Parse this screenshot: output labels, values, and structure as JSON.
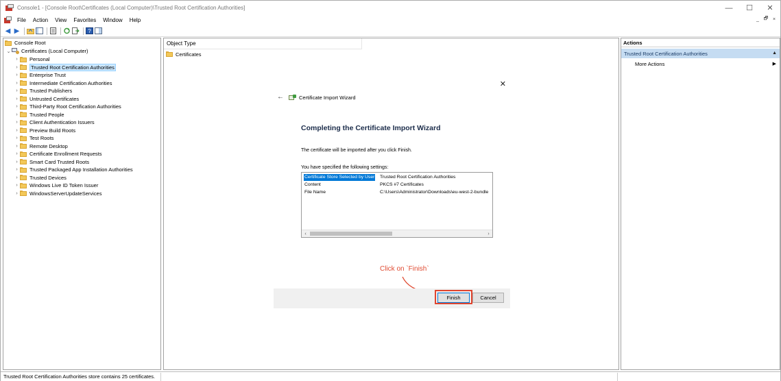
{
  "window": {
    "title": "Console1 - [Console Root\\Certificates (Local Computer)\\Trusted Root Certification Authorities]",
    "minimize_glyph": "—",
    "maximize_glyph": "☐",
    "close_glyph": "✕"
  },
  "menu": [
    "File",
    "Action",
    "View",
    "Favorites",
    "Window",
    "Help"
  ],
  "mdi": {
    "minimize": "_",
    "restore": "🗗",
    "close": "×"
  },
  "tree": {
    "root": "Console Root",
    "computer": "Certificates (Local Computer)",
    "items": [
      "Personal",
      "Trusted Root Certification Authorities",
      "Enterprise Trust",
      "Intermediate Certification Authorities",
      "Trusted Publishers",
      "Untrusted Certificates",
      "Third-Party Root Certification Authorities",
      "Trusted People",
      "Client Authentication Issuers",
      "Preview Build Roots",
      "Test Roots",
      "Remote Desktop",
      "Certificate Enrollment Requests",
      "Smart Card Trusted Roots",
      "Trusted Packaged App Installation Authorities",
      "Trusted Devices",
      "Windows Live ID Token Issuer",
      "WindowsServerUpdateServices"
    ],
    "selected_index": 1
  },
  "center": {
    "column_header": "Object Type",
    "list_item": "Certificates"
  },
  "wizard": {
    "window_title": "Certificate Import Wizard",
    "heading": "Completing the Certificate Import Wizard",
    "text1": "The certificate will be imported after you click Finish.",
    "text2": "You have specified the following settings:",
    "settings": [
      {
        "key": "Certificate Store Selected by User",
        "value": "Trusted Root Certification Authorities"
      },
      {
        "key": "Content",
        "value": "PKCS #7 Certificates"
      },
      {
        "key": "File Name",
        "value": "C:\\Users\\Administrator\\Downloads\\eu-west-2-bundle"
      }
    ],
    "annotation": "Click on `Finish`",
    "finish_label": "Finish",
    "cancel_label": "Cancel"
  },
  "actions": {
    "header": "Actions",
    "section": "Trusted Root Certification Authorities",
    "more": "More Actions"
  },
  "status": "Trusted Root Certification Authorities store contains 25 certificates."
}
